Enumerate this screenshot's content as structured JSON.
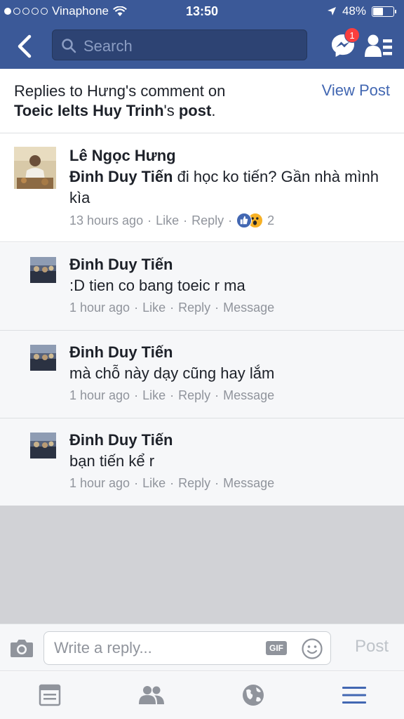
{
  "status_bar": {
    "carrier": "Vinaphone",
    "time": "13:50",
    "battery": "48%",
    "battery_level": 0.48
  },
  "nav": {
    "search_placeholder": "Search",
    "messenger_badge": "1"
  },
  "header": {
    "prefix": "Replies to Hưng's comment on",
    "page_name": "Toeic Ielts Huy Trinh",
    "possessive": "'s",
    "post_word": "post",
    "period": ".",
    "view_post": "View Post"
  },
  "main_comment": {
    "author": "Lê Ngọc Hưng",
    "mention": "Đinh Duy Tiến",
    "text": " đi học ko tiến? Gần nhà mình kìa",
    "time": "13 hours ago",
    "like": "Like",
    "reply": "Reply",
    "reaction_count": "2",
    "sep": "·"
  },
  "replies": [
    {
      "author": "Đinh Duy Tiến",
      "text": ":D tien co bang toeic r ma",
      "time": "1 hour ago",
      "like": "Like",
      "reply": "Reply",
      "message": "Message",
      "sep": "·"
    },
    {
      "author": "Đinh Duy Tiến",
      "text": "mà chỗ này dạy cũng hay lắm",
      "time": "1 hour ago",
      "like": "Like",
      "reply": "Reply",
      "message": "Message",
      "sep": "·"
    },
    {
      "author": "Đinh Duy Tiến",
      "text": "bạn tiến kể r",
      "time": "1 hour ago",
      "like": "Like",
      "reply": "Reply",
      "message": "Message",
      "sep": "·"
    }
  ],
  "composer": {
    "placeholder": "Write a reply...",
    "gif": "GIF",
    "post": "Post"
  },
  "colors": {
    "brand": "#3b5998",
    "link": "#4267b2",
    "tab_active": "#4267b2",
    "tab_inactive": "#90949c"
  }
}
